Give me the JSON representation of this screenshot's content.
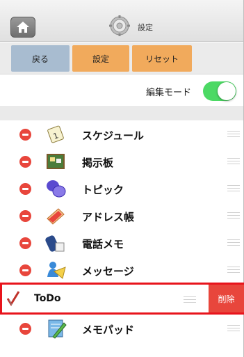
{
  "header": {
    "title": "設定"
  },
  "toolbar": {
    "back_label": "戻る",
    "settings_label": "設定",
    "reset_label": "リセット"
  },
  "edit_mode": {
    "label": "編集モード",
    "enabled": true
  },
  "list": {
    "items": [
      {
        "label": "スケジュール",
        "icon": "schedule-icon"
      },
      {
        "label": "掲示板",
        "icon": "bulletin-board-icon"
      },
      {
        "label": "トピック",
        "icon": "topic-icon"
      },
      {
        "label": "アドレス帳",
        "icon": "address-book-icon"
      },
      {
        "label": "電話メモ",
        "icon": "phone-memo-icon"
      },
      {
        "label": "メッセージ",
        "icon": "message-icon"
      },
      {
        "label": "ToDo",
        "icon": "todo-icon",
        "swiped": true,
        "action_label": "削除"
      },
      {
        "label": "メモパッド",
        "icon": "memopad-icon"
      }
    ]
  },
  "colors": {
    "accent_orange": "#f1aa5c",
    "back_blue": "#a8bcd0",
    "toggle_green": "#4cd964",
    "delete_red": "#e8463c",
    "highlight_red": "#e8141c"
  }
}
